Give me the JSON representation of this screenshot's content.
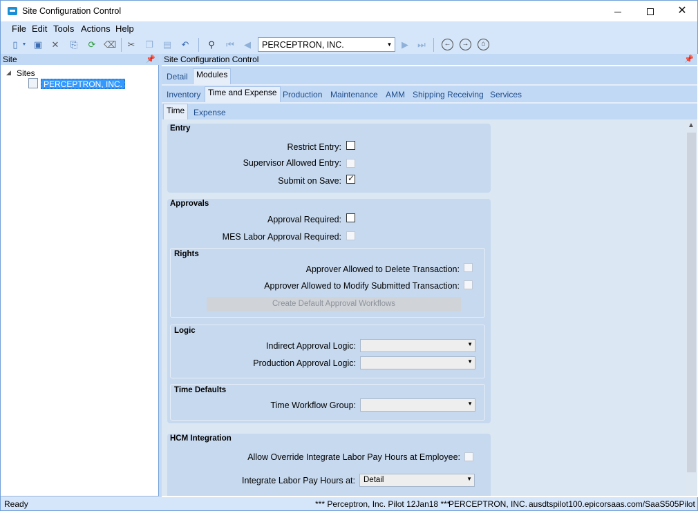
{
  "window": {
    "title": "Site Configuration Control"
  },
  "menu": {
    "file": "File",
    "edit": "Edit",
    "tools": "Tools",
    "actions": "Actions",
    "help": "Help"
  },
  "toolbar": {
    "company_combo": "PERCEPTRON, INC."
  },
  "left_panel": {
    "header": "Site",
    "tree_root": "Sites",
    "tree_node": "PERCEPTRON, INC."
  },
  "right_panel": {
    "header": "Site Configuration Control",
    "top_tabs": [
      "Detail",
      "Modules"
    ],
    "module_tabs": [
      "Inventory",
      "Time and Expense",
      "Production",
      "Maintenance",
      "AMM",
      "Shipping Receiving",
      "Services"
    ],
    "sub_tabs": [
      "Time",
      "Expense"
    ]
  },
  "entry": {
    "title": "Entry",
    "restrict_entry": "Restrict Entry:",
    "supervisor_allowed": "Supervisor Allowed Entry:",
    "submit_on_save": "Submit on Save:"
  },
  "approvals": {
    "title": "Approvals",
    "approval_required": "Approval Required:",
    "mes_labor": "MES Labor Approval Required:",
    "rights_title": "Rights",
    "approver_delete": "Approver Allowed to Delete Transaction:",
    "approver_modify": "Approver Allowed to Modify Submitted Transaction:",
    "create_workflows": "Create Default Approval Workflows",
    "logic_title": "Logic",
    "indirect_logic": "Indirect Approval Logic:",
    "production_logic": "Production Approval Logic:",
    "time_defaults_title": "Time Defaults",
    "time_workflow_group": "Time Workflow Group:"
  },
  "hcm": {
    "title": "HCM Integration",
    "allow_override": "Allow Override Integrate Labor Pay Hours at Employee:",
    "integrate_at": "Integrate Labor Pay Hours at:",
    "integrate_at_value": "Detail"
  },
  "status": {
    "state": "Ready",
    "pilot": "*** Perceptron, Inc. Pilot 12Jan18 ***",
    "company": "PERCEPTRON, INC.",
    "server": "ausdtspilot100.epicorsaas.com/SaaS505Pilot"
  }
}
